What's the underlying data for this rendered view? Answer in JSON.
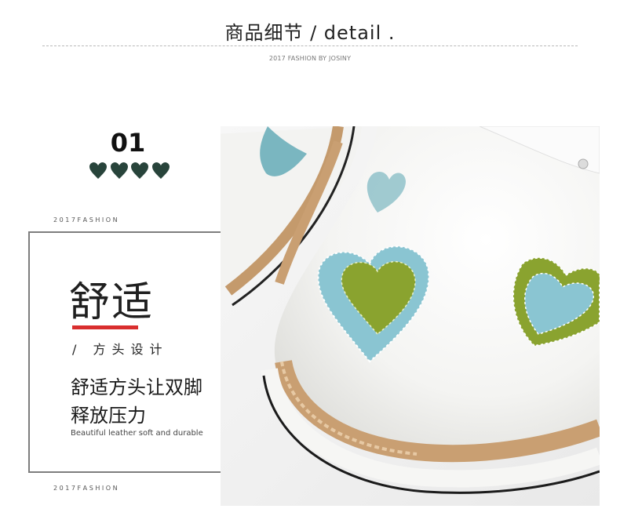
{
  "header": {
    "title": "商品细节 / detail .",
    "subtitle": "2017 FASHION BY JOSINY"
  },
  "feature": {
    "number": "01",
    "hearts_count": 4,
    "heart_color": "#28443b",
    "fashion_top": "2 0 1 7   F A S H I O N",
    "fashion_bottom": "2 0 1 7   F A S H I O N",
    "title": "舒适",
    "subtitle": "/ 方头设计",
    "description_line1": "舒适方头让双脚",
    "description_line2": "释放压力",
    "english": "Beautiful leather soft and durable",
    "accent_color": "#d92e2e"
  },
  "photo": {
    "subject": "white-patent-shoe-toe-with-heart-patches",
    "heart_colors": [
      "#8ac5d2",
      "#8aa32f"
    ]
  }
}
